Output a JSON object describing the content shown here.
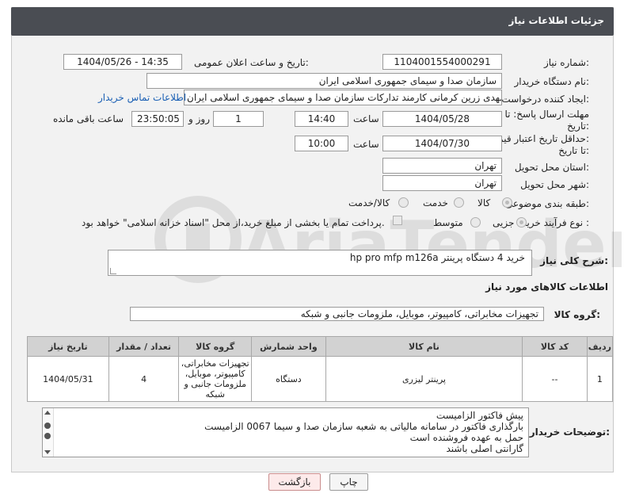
{
  "header": {
    "title": "جزئیات اطلاعات نیاز"
  },
  "form": {
    "need_number_label": "شماره نیاز:",
    "need_number": "1104001554000291",
    "announce_label": "تاریخ و ساعت اعلان عمومی:",
    "announce_value": "1404/05/26 - 14:35",
    "buyer_org_label": "نام دستگاه خریدار:",
    "buyer_org": "سازمان صدا و سیمای جمهوری اسلامی ایران",
    "creator_label": "ایجاد کننده درخواست:",
    "creator": "مهدی زرین کرمانی کارمند تدارکات سازمان صدا و سیمای جمهوری اسلامی ایران",
    "contact_link": "اطلاعات تماس خریدار",
    "deadline_label_1": "مهلت ارسال پاسخ: تا",
    "deadline_label_2": "تاریخ:",
    "deadline_date": "1404/05/28",
    "time_label": "ساعت",
    "deadline_time": "14:40",
    "days_value": "1",
    "days_label": "روز و",
    "remaining_time": "23:50:05",
    "remaining_label": "ساعت باقی مانده",
    "validity_label_1": "حداقل تاریخ اعتبار قیمت:",
    "validity_label_2": "تا تاریخ:",
    "validity_date": "1404/07/30",
    "validity_time_label": "ساعت",
    "validity_time": "10:00",
    "province_label": "استان محل تحویل:",
    "province": "تهران",
    "city_label": "شهر محل تحویل:",
    "city": "تهران",
    "category_label": "طبقه بندی موضوعی:",
    "category_options": [
      "کالا",
      "خدمت",
      "کالا/خدمت"
    ],
    "process_label": "نوع فرآیند خرید :",
    "process_options": [
      "جزیی",
      "متوسط"
    ],
    "payment_note": "پرداخت تمام یا بخشی از مبلغ خرید،از محل \"اسناد خزانه اسلامی\" خواهد بود."
  },
  "description": {
    "label": "شرح کلی نیاز:",
    "value": "خرید 4 دستگاه پرینتر hp pro mfp m126a"
  },
  "goods_section": {
    "title": "اطلاعات کالاهای مورد نیاز",
    "group_label": "گروه کالا:",
    "group_value": "تجهیزات مخابراتی، کامپیوتر، موبایل، ملزومات جانبی و شبکه"
  },
  "table": {
    "headers": [
      "ردیف",
      "کد کالا",
      "نام کالا",
      "واحد شمارش",
      "گروه کالا",
      "تعداد / مقدار",
      "تاریخ نیاز"
    ],
    "rows": [
      {
        "row": "1",
        "code": "--",
        "name": "پرینتر لیزری",
        "unit": "دستگاه",
        "group_l1": "تجهیزات مخابراتی،",
        "group_l2": "کامپیوتر، موبایل،",
        "group_l3": "ملزومات جانبی و",
        "group_l4": "شبکه",
        "qty": "4",
        "date": "1404/05/31"
      }
    ]
  },
  "notes": {
    "label": "توضیحات خریدار:",
    "lines": [
      "پیش فاکتور الزامیست",
      "بارگذاری فاکتور در سامانه مالیاتی به شعبه سازمان صدا و سیما 0067 الزامیست",
      "حمل به عهده فروشنده است",
      "گارانتی اصلی باشند"
    ]
  },
  "buttons": {
    "print": "چاپ",
    "back": "بازگشت"
  },
  "watermark": {
    "text": "AriaTender.net"
  }
}
